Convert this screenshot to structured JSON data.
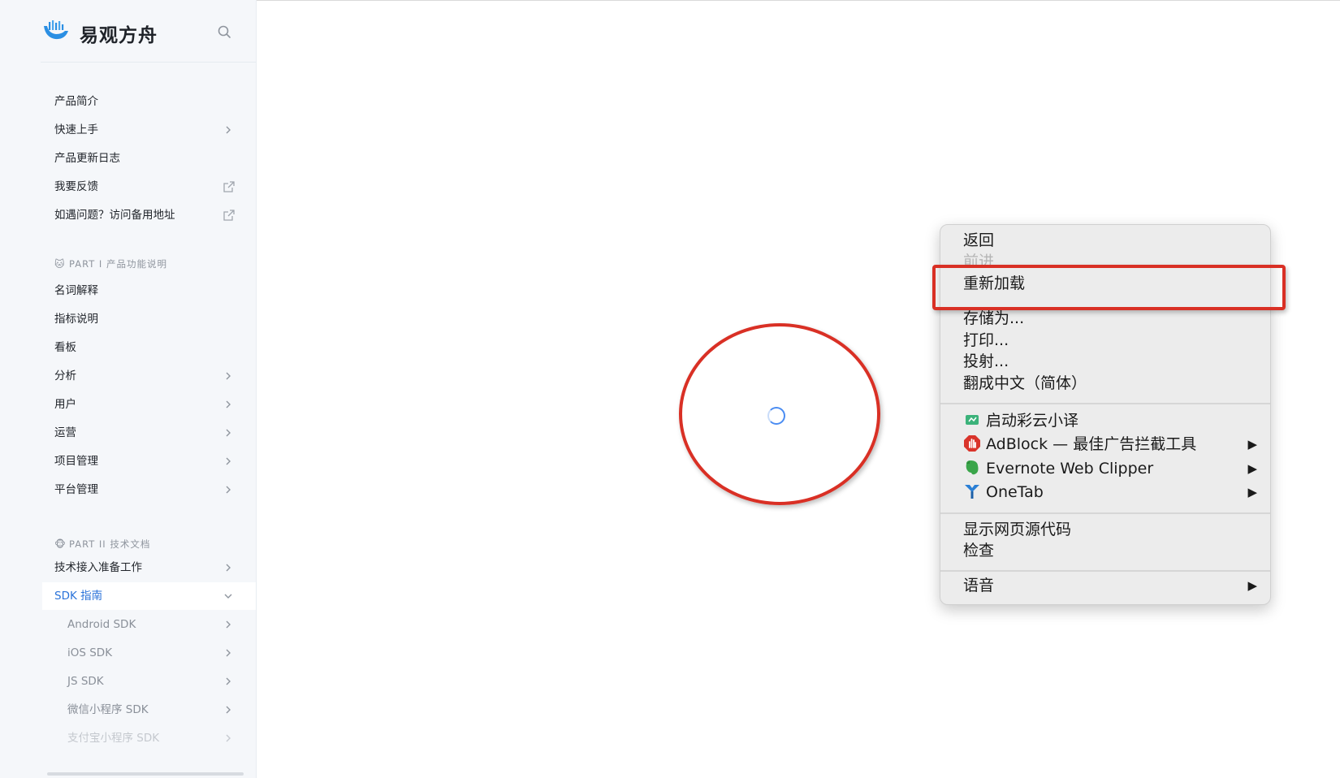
{
  "brand": {
    "name": "易观方舟"
  },
  "sidebar": {
    "top_items": [
      {
        "label": "产品简介",
        "suffix": ""
      },
      {
        "label": "快速上手",
        "suffix": "chevron-right-icon"
      },
      {
        "label": "产品更新日志",
        "suffix": ""
      },
      {
        "label": "我要反馈",
        "suffix": "external-link-icon"
      },
      {
        "label": "如遇问题？访问备用地址",
        "suffix": "external-link-icon"
      }
    ],
    "section1": {
      "emoji": "🐱",
      "label": "PART I 产品功能说明"
    },
    "section1_items": [
      {
        "label": "名词解释",
        "suffix": ""
      },
      {
        "label": "指标说明",
        "suffix": ""
      },
      {
        "label": "看板",
        "suffix": ""
      },
      {
        "label": "分析",
        "suffix": "chevron-right-icon"
      },
      {
        "label": "用户",
        "suffix": "chevron-right-icon"
      },
      {
        "label": "运营",
        "suffix": "chevron-right-icon"
      },
      {
        "label": "项目管理",
        "suffix": "chevron-right-icon"
      },
      {
        "label": "平台管理",
        "suffix": "chevron-right-icon"
      }
    ],
    "section2": {
      "emoji": "🐵",
      "label": "PART II 技术文档"
    },
    "section2_items": [
      {
        "label": "技术接入准备工作",
        "suffix": "chevron-right-icon"
      },
      {
        "label": "SDK 指南",
        "suffix": "chevron-down-icon",
        "active": true
      }
    ],
    "sdk_items": [
      {
        "label": "Android SDK"
      },
      {
        "label": "iOS SDK"
      },
      {
        "label": "JS SDK"
      },
      {
        "label": "微信小程序 SDK"
      },
      {
        "label": "支付宝小程序 SDK"
      }
    ]
  },
  "context_menu": {
    "back": "返回",
    "forward": "前进",
    "reload": "重新加载",
    "save_as": "存储为...",
    "print": "打印...",
    "cast": "投射...",
    "translate": "翻成中文（简体）",
    "extensions": [
      {
        "label": "启动彩云小译",
        "icon": "caiyun-icon",
        "submenu": false
      },
      {
        "label": "AdBlock — 最佳广告拦截工具",
        "icon": "adblock-icon",
        "submenu": true
      },
      {
        "label": "Evernote Web Clipper",
        "icon": "evernote-icon",
        "submenu": true
      },
      {
        "label": "OneTab",
        "icon": "onetab-icon",
        "submenu": true
      }
    ],
    "view_source": "显示网页源代码",
    "inspect": "检查",
    "speech": "语音",
    "submenu_arrow": "▶"
  },
  "colors": {
    "accent": "#2b73d9",
    "annotation_red": "#d93025",
    "menu_bg": "#ececec",
    "sidebar_bg": "#f5f7fa"
  }
}
